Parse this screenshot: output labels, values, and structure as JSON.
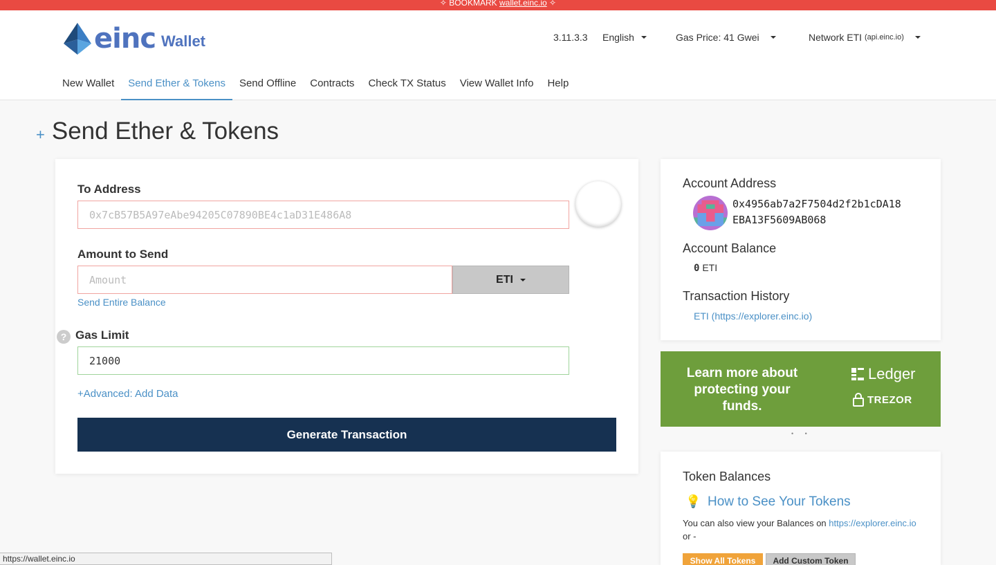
{
  "banner": {
    "prefix": "✧ BOOKMARK ",
    "link": "wallet.einc.io",
    "suffix": " ✧"
  },
  "header": {
    "logo_brand": "einc",
    "logo_product": "Wallet",
    "version": "3.11.3.3",
    "language": "English",
    "gas_price": "Gas Price: 41 Gwei",
    "network": "Network ETI",
    "network_host": "(api.einc.io)"
  },
  "nav": {
    "items": [
      "New Wallet",
      "Send Ether & Tokens",
      "Send Offline",
      "Contracts",
      "Check TX Status",
      "View Wallet Info",
      "Help"
    ],
    "active_index": 1
  },
  "page": {
    "plus": "+",
    "title": "Send Ether & Tokens"
  },
  "form": {
    "to_label": "To Address",
    "to_placeholder": "0x7cB57B5A97eAbe94205C07890BE4c1aD31E486A8",
    "amount_label": "Amount to Send",
    "amount_placeholder": "Amount",
    "unit": "ETI",
    "send_entire": "Send Entire Balance",
    "help_glyph": "?",
    "gas_label": "Gas Limit",
    "gas_value": "21000",
    "advanced": "+Advanced: Add Data",
    "generate": "Generate Transaction"
  },
  "account": {
    "address_label": "Account Address",
    "address_line1": "0x4956ab7a2F7504d2f2b1cDA18",
    "address_line2": "EBA13F5609AB068",
    "balance_label": "Account Balance",
    "balance_value": "0",
    "balance_unit": "ETI",
    "history_label": "Transaction History",
    "history_link": "ETI (https://explorer.einc.io)"
  },
  "promo": {
    "text": "Learn more about protecting your funds.",
    "ledger": "Ledger",
    "trezor": "TREZOR",
    "dots": "• •"
  },
  "tokens": {
    "title": "Token Balances",
    "howto": "How to See Your Tokens",
    "para_prefix": "You can also view your Balances on ",
    "para_link": "https://explorer.einc.io",
    "para_suffix": " or -",
    "show_all": "Show All Tokens",
    "add_custom": "Add Custom Token"
  },
  "status_url": "https://wallet.einc.io",
  "colors": {
    "accent": "#4a90c6",
    "banner": "#e94a42",
    "primary_button": "#163151",
    "promo": "#6e9e3c",
    "show_all": "#f0a33a"
  }
}
